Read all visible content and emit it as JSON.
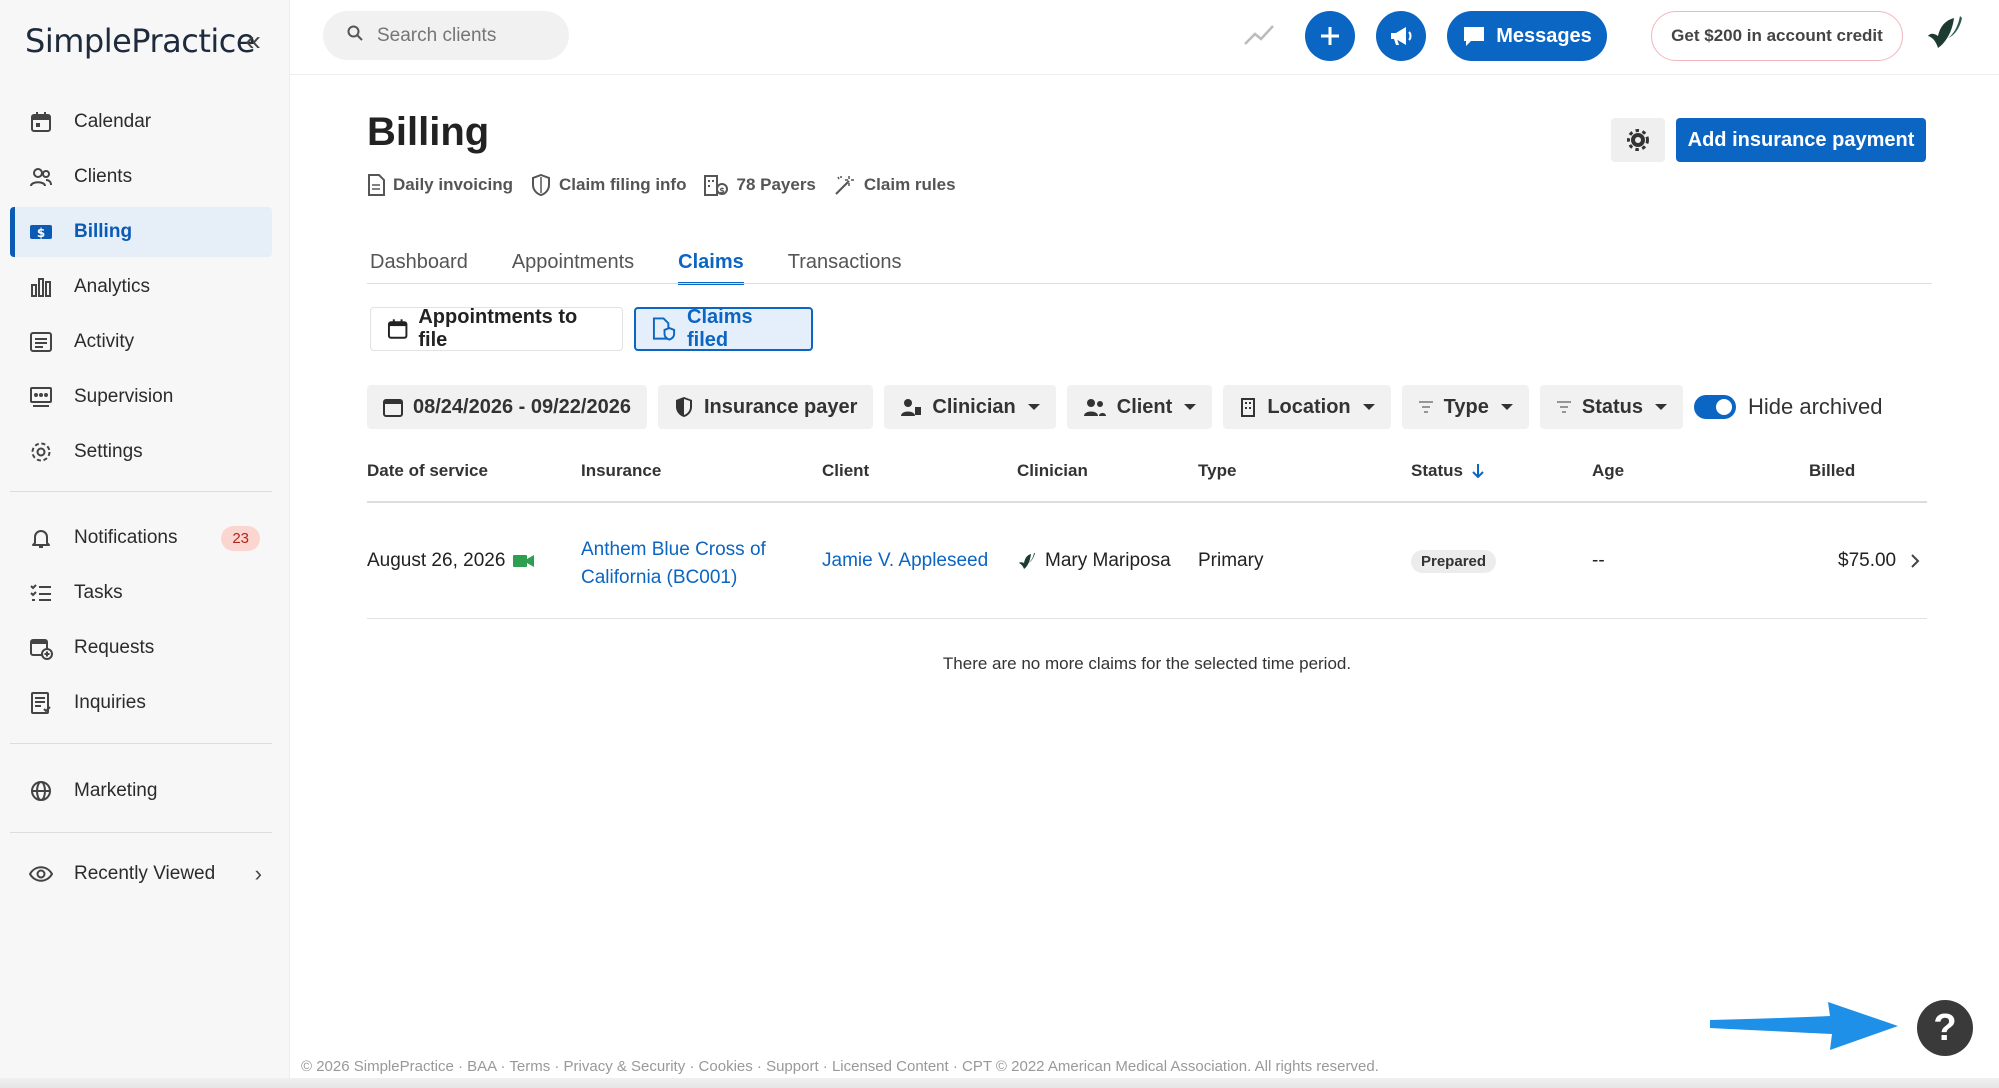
{
  "brand": {
    "logo": "SimplePractice",
    "collapse_icon": "double-chevron-left-icon"
  },
  "sidebar": {
    "items": [
      {
        "label": "Calendar",
        "icon": "calendar-icon"
      },
      {
        "label": "Clients",
        "icon": "users-icon"
      },
      {
        "label": "Billing",
        "icon": "dollar-bill-icon",
        "active": true
      },
      {
        "label": "Analytics",
        "icon": "bar-chart-icon"
      },
      {
        "label": "Activity",
        "icon": "list-icon"
      },
      {
        "label": "Supervision",
        "icon": "supervision-icon"
      },
      {
        "label": "Settings",
        "icon": "gear-icon"
      }
    ],
    "items2": [
      {
        "label": "Notifications",
        "icon": "bell-icon",
        "badge": "23"
      },
      {
        "label": "Tasks",
        "icon": "tasks-icon"
      },
      {
        "label": "Requests",
        "icon": "calendar-plus-icon"
      },
      {
        "label": "Inquiries",
        "icon": "inquiries-icon"
      }
    ],
    "marketing": {
      "label": "Marketing",
      "icon": "globe-icon"
    },
    "recently_viewed": {
      "label": "Recently Viewed",
      "icon": "eye-icon"
    }
  },
  "header": {
    "search_placeholder": "Search clients",
    "messages_label": "Messages",
    "credit_label": "Get $200 in account credit"
  },
  "page": {
    "title": "Billing",
    "sublinks": [
      "Daily invoicing",
      "Claim filing info",
      "78 Payers",
      "Claim rules"
    ],
    "add_payment_label": "Add insurance payment",
    "tabs": [
      "Dashboard",
      "Appointments",
      "Claims",
      "Transactions"
    ],
    "active_tab": "Claims",
    "segments": [
      "Appointments to file",
      "Claims filed"
    ],
    "filters": {
      "date_range": "08/24/2026 - 09/22/2026",
      "insurance_payer": "Insurance payer",
      "clinician": "Clinician",
      "client": "Client",
      "location": "Location",
      "type": "Type",
      "status": "Status",
      "hide_archived": "Hide archived"
    }
  },
  "table": {
    "columns": [
      "Date of service",
      "Insurance",
      "Client",
      "Clinician",
      "Type",
      "Status",
      "Age",
      "Billed"
    ],
    "rows": [
      {
        "date": "August 26, 2026",
        "insurance_line1": "Anthem Blue Cross of",
        "insurance_line2": "California (BC001)",
        "client": "Jamie V. Appleseed",
        "clinician": "Mary Mariposa",
        "type": "Primary",
        "status": "Prepared",
        "age": "--",
        "billed": "$75.00"
      }
    ],
    "empty_note": "There are no more claims for the selected time period."
  },
  "footer": "© 2026 SimplePractice · BAA · Terms · Privacy & Security · Cookies · Support · Licensed Content · CPT © 2022 American Medical Association. All rights reserved.",
  "help_label": "?",
  "colors": {
    "accent": "#0b65c2",
    "badge_bg": "#fbd6d0",
    "badge_text": "#b3261e"
  }
}
